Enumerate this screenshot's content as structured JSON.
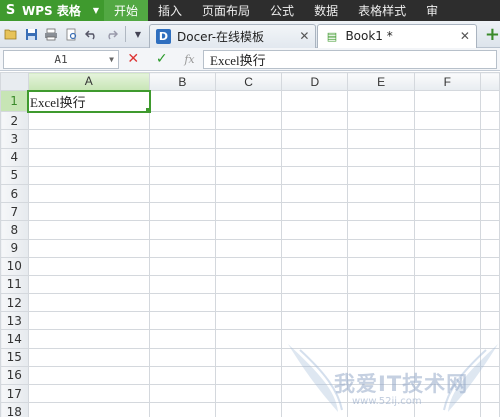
{
  "app": {
    "name": "WPS 表格",
    "logo": "S"
  },
  "menu": [
    "开始",
    "插入",
    "页面布局",
    "公式",
    "数据",
    "表格样式",
    "审"
  ],
  "menu_active": 0,
  "tabs": [
    {
      "label": "Docer-在线模板",
      "icon": "D",
      "close": "✕"
    },
    {
      "label": "Book1 *",
      "icon": "▤",
      "close": "✕"
    }
  ],
  "add_tab": "+",
  "formula_bar": {
    "cell_ref": "A1",
    "cancel": "✕",
    "confirm": "✓",
    "fx": "fx",
    "content": "Excel换行"
  },
  "columns": [
    "A",
    "B",
    "C",
    "D",
    "E",
    "F"
  ],
  "rows": [
    "1",
    "2",
    "3",
    "4",
    "5",
    "6",
    "7",
    "8",
    "9",
    "10",
    "11",
    "12",
    "13",
    "14",
    "15",
    "16",
    "17",
    "18"
  ],
  "cells": {
    "A1": "Excel换行"
  },
  "watermark": {
    "text": "我爱IT技术网",
    "url": "www.52ij.com"
  },
  "colors": {
    "accent": "#3f9a2e",
    "menubar": "#2d2d2d"
  }
}
